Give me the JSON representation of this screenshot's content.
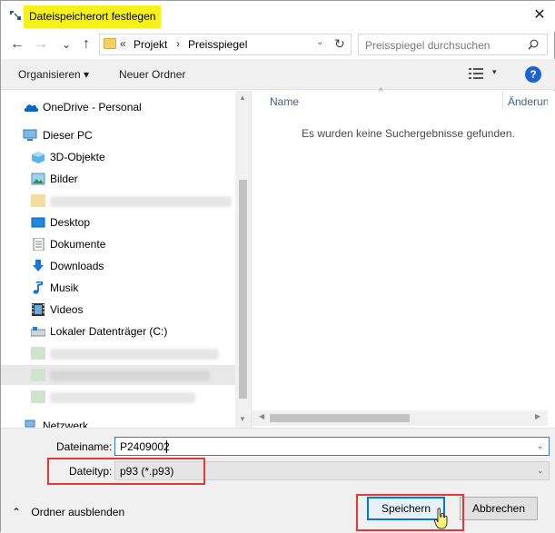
{
  "window": {
    "title": "Dateispeicherort festlegen",
    "close_glyph": "✕",
    "highlight_color": "#f7f11b"
  },
  "nav": {
    "back_glyph": "←",
    "forward_glyph": "→",
    "recent_glyph": "⌄",
    "up_glyph": "↑"
  },
  "address": {
    "overflow": "«",
    "segments": [
      "Projekt",
      "Preisspiegel"
    ],
    "separator": "›",
    "dropdown_glyph": "⌄",
    "refresh_glyph": "↻"
  },
  "search": {
    "placeholder": "Preisspiegel durchsuchen"
  },
  "commandbar": {
    "organize_label": "Organisieren ▾",
    "new_folder_label": "Neuer Ordner",
    "view_dropdown_glyph": "▾",
    "help_label": "?"
  },
  "sidebar": {
    "items": [
      {
        "label": "OneDrive - Personal",
        "icon": "onedrive-cloud-icon"
      },
      {
        "label": "Dieser PC",
        "icon": "computer-icon"
      },
      {
        "label": "3D-Objekte",
        "icon": "3d-objects-icon"
      },
      {
        "label": "Bilder",
        "icon": "pictures-icon"
      },
      {
        "label": "",
        "icon": "folder-icon",
        "blurred": true
      },
      {
        "label": "Desktop",
        "icon": "desktop-icon"
      },
      {
        "label": "Dokumente",
        "icon": "documents-icon"
      },
      {
        "label": "Downloads",
        "icon": "downloads-icon"
      },
      {
        "label": "Musik",
        "icon": "music-icon"
      },
      {
        "label": "Videos",
        "icon": "videos-icon"
      },
      {
        "label": "Lokaler Datenträger (C:)",
        "icon": "drive-icon"
      },
      {
        "label": "",
        "icon": "network-drive-icon",
        "blurred": true
      },
      {
        "label": "",
        "icon": "network-drive-icon",
        "blurred": true
      },
      {
        "label": "",
        "icon": "network-drive-icon",
        "blurred": true
      },
      {
        "label": "Netzwerk",
        "icon": "network-icon"
      }
    ]
  },
  "filelist": {
    "columns": [
      "Name",
      "Änderung"
    ],
    "sort_glyph": "^",
    "empty_message": "Es wurden keine Suchergebnisse gefunden."
  },
  "form": {
    "filename_label": "Dateiname:",
    "filename_value": "P2409002",
    "filetype_label": "Dateityp:",
    "filetype_value": "p93 (*.p93)",
    "dropdown_glyph": "⌄"
  },
  "footer": {
    "hide_folders_label": "Ordner ausblenden",
    "hide_folders_glyph": "⌃",
    "save_label": "Speichern",
    "cancel_label": "Abbrechen"
  },
  "annotations": {
    "box_color": "#e23a3a"
  },
  "scroll": {
    "up": "▲",
    "down": "▼",
    "left": "◀",
    "right": "▶"
  }
}
